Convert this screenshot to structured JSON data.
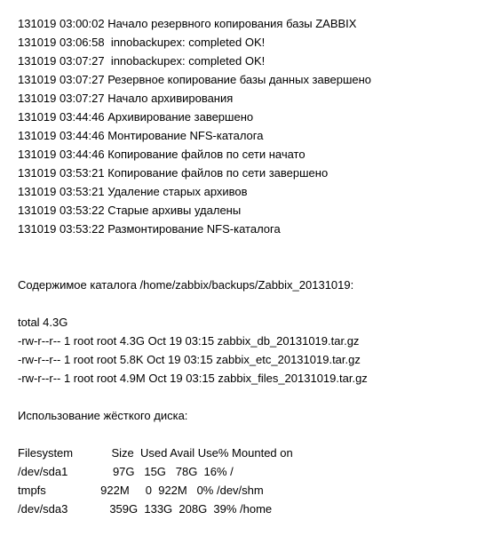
{
  "log_lines": [
    "131019 03:00:02 Начало резервного копирования базы ZABBIX",
    "131019 03:06:58  innobackupex: completed OK!",
    "131019 03:07:27  innobackupex: completed OK!",
    "131019 03:07:27 Резервное копирование базы данных завершено",
    "131019 03:07:27 Начало архивирования",
    "131019 03:44:46 Архивирование завершено",
    "131019 03:44:46 Монтирование NFS-каталога",
    "131019 03:44:46 Копирование файлов по сети начато",
    "131019 03:53:21 Копирование файлов по сети завершено",
    "131019 03:53:21 Удаление старых архивов",
    "131019 03:53:22 Старые архивы удалены",
    "131019 03:53:22 Размонтирование NFS-каталога"
  ],
  "dir_heading": "Содержимое каталога /home/zabbix/backups/Zabbix_20131019:",
  "ls_total": "total 4.3G",
  "ls_files": [
    "-rw-r--r-- 1 root root 4.3G Oct 19 03:15 zabbix_db_20131019.tar.gz",
    "-rw-r--r-- 1 root root 5.8K Oct 19 03:15 zabbix_etc_20131019.tar.gz",
    "-rw-r--r-- 1 root root 4.9M Oct 19 03:15 zabbix_files_20131019.tar.gz"
  ],
  "disk_heading": "Использование жёсткого диска:",
  "df_header": "Filesystem            Size  Used Avail Use% Mounted on",
  "df_rows": [
    "/dev/sda1              97G   15G   78G  16% /",
    "tmpfs                 922M     0  922M   0% /dev/shm",
    "/dev/sda3             359G  133G  208G  39% /home"
  ]
}
